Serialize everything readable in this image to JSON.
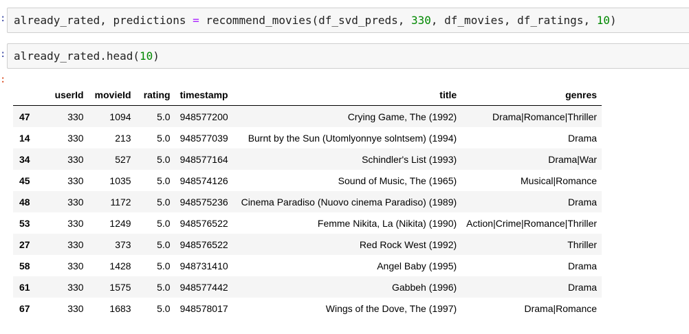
{
  "cells": {
    "line1": {
      "a": "already_rated, predictions ",
      "op": "=",
      "b": " recommend_movies(df_svd_preds, ",
      "n1": "330",
      "c": ", df_movies, df_ratings, ",
      "n2": "10",
      "d": ")"
    },
    "line2": {
      "a": "already_rated.head(",
      "n1": "10",
      "d": ")"
    }
  },
  "table": {
    "columns": [
      "",
      "userId",
      "movieId",
      "rating",
      "timestamp",
      "title",
      "genres"
    ],
    "rows": [
      {
        "idx": "47",
        "userId": "330",
        "movieId": "1094",
        "rating": "5.0",
        "timestamp": "948577200",
        "title": "Crying Game, The (1992)",
        "genres": "Drama|Romance|Thriller"
      },
      {
        "idx": "14",
        "userId": "330",
        "movieId": "213",
        "rating": "5.0",
        "timestamp": "948577039",
        "title": "Burnt by the Sun (Utomlyonnye solntsem) (1994)",
        "genres": "Drama"
      },
      {
        "idx": "34",
        "userId": "330",
        "movieId": "527",
        "rating": "5.0",
        "timestamp": "948577164",
        "title": "Schindler's List (1993)",
        "genres": "Drama|War"
      },
      {
        "idx": "45",
        "userId": "330",
        "movieId": "1035",
        "rating": "5.0",
        "timestamp": "948574126",
        "title": "Sound of Music, The (1965)",
        "genres": "Musical|Romance"
      },
      {
        "idx": "48",
        "userId": "330",
        "movieId": "1172",
        "rating": "5.0",
        "timestamp": "948575236",
        "title": "Cinema Paradiso (Nuovo cinema Paradiso) (1989)",
        "genres": "Drama"
      },
      {
        "idx": "53",
        "userId": "330",
        "movieId": "1249",
        "rating": "5.0",
        "timestamp": "948576522",
        "title": "Femme Nikita, La (Nikita) (1990)",
        "genres": "Action|Crime|Romance|Thriller"
      },
      {
        "idx": "27",
        "userId": "330",
        "movieId": "373",
        "rating": "5.0",
        "timestamp": "948576522",
        "title": "Red Rock West (1992)",
        "genres": "Thriller"
      },
      {
        "idx": "58",
        "userId": "330",
        "movieId": "1428",
        "rating": "5.0",
        "timestamp": "948731410",
        "title": "Angel Baby (1995)",
        "genres": "Drama"
      },
      {
        "idx": "61",
        "userId": "330",
        "movieId": "1575",
        "rating": "5.0",
        "timestamp": "948577442",
        "title": "Gabbeh (1996)",
        "genres": "Drama"
      },
      {
        "idx": "67",
        "userId": "330",
        "movieId": "1683",
        "rating": "5.0",
        "timestamp": "948578017",
        "title": "Wings of the Dove, The (1997)",
        "genres": "Drama|Romance"
      }
    ]
  },
  "colors": {
    "operator": "#aa22ff",
    "number": "#008800",
    "cell_background": "#f7f7f7"
  }
}
